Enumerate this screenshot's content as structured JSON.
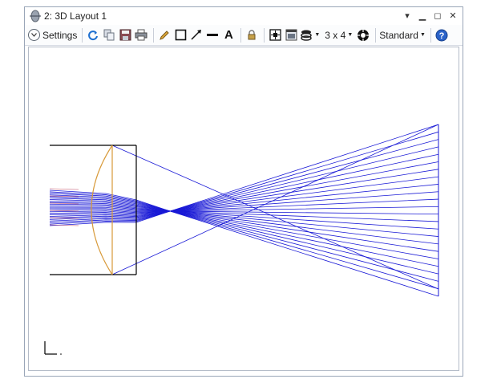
{
  "window": {
    "title": "2: 3D Layout 1",
    "app_icon": "lens-app-icon",
    "controls": [
      "chevron-down-icon",
      "minimize-icon",
      "maximize-icon",
      "close-icon"
    ]
  },
  "toolbar": {
    "settings_label": "Settings",
    "layout_value": "3 x 4",
    "view_mode": "Standard",
    "icons": [
      "refresh-icon",
      "copy-icon",
      "save-icon",
      "print-icon",
      "pencil-icon",
      "rectangle-icon",
      "arrow-icon",
      "line-icon",
      "text-icon",
      "lock-icon",
      "fit-icon",
      "window-icon",
      "layers-icon",
      "settings-gear-icon",
      "help-icon"
    ]
  },
  "colors": {
    "rays": "#1a1ad6",
    "lens_edge": "#d89a3a",
    "accent_rays": "#c0506a",
    "outline": "#000000"
  }
}
